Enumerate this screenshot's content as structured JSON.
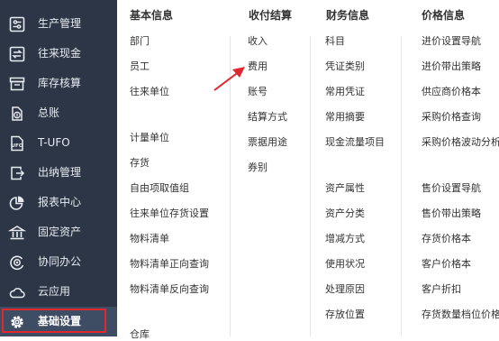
{
  "sidebar": {
    "items": [
      {
        "label": "生产管理",
        "icon": "sliders-icon"
      },
      {
        "label": "往来现金",
        "icon": "exchange-icon"
      },
      {
        "label": "库存核算",
        "icon": "inventory-icon"
      },
      {
        "label": "总账",
        "icon": "ledger-icon"
      },
      {
        "label": "T-UFO",
        "icon": "ufo-report-icon"
      },
      {
        "label": "出纳管理",
        "icon": "cashier-icon"
      },
      {
        "label": "报表中心",
        "icon": "pie-chart-icon"
      },
      {
        "label": "固定资产",
        "icon": "bank-building-icon"
      },
      {
        "label": "协同办公",
        "icon": "collaboration-icon"
      },
      {
        "label": "云应用",
        "icon": "cloud-icon"
      },
      {
        "label": "基础设置",
        "icon": "gear-icon",
        "active": true
      }
    ],
    "active_outline_color": "#e0282e",
    "background": "#2c3646"
  },
  "columns": [
    {
      "header": "基本信息",
      "items": [
        "部门",
        "员工",
        "往来单位",
        "计量单位",
        "存货",
        "自由项取值组",
        "往来单位存货设置",
        "物料清单",
        "物料清单正向查询",
        "物料清单反向查询",
        "仓库"
      ]
    },
    {
      "header": "收付结算",
      "items": [
        "收入",
        "费用",
        "账号",
        "结算方式",
        "票据用途",
        "券别"
      ]
    },
    {
      "header": "财务信息",
      "items": [
        "科目",
        "凭证类别",
        "常用凭证",
        "常用摘要",
        "现金流量项目",
        "资产属性",
        "资产分类",
        "增减方式",
        "使用状况",
        "处理原因",
        "存放位置"
      ]
    },
    {
      "header": "价格信息",
      "items": [
        "进价设置导航",
        "进价带出策略",
        "供应商价格本",
        "采购价格查询",
        "采购价格波动分析",
        "售价设置导航",
        "售价带出策略",
        "存货价格本",
        "客户价格本",
        "客户折扣",
        "存货数量档位价格"
      ]
    }
  ],
  "annotation": {
    "color": "#e0282e",
    "points_to": "费用"
  }
}
